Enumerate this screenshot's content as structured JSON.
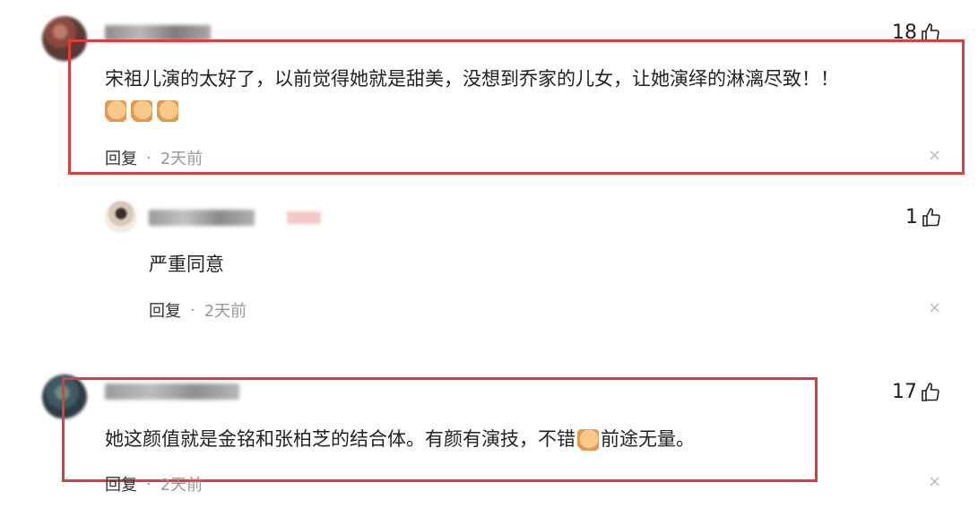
{
  "comments": [
    {
      "likes": "18",
      "text": "宋祖儿演的太好了，以前觉得她就是甜美，没想到乔家的儿女，让她演绎的淋漓尽致！！",
      "emoji": [
        "thumbs-up",
        "thumbs-up",
        "thumbs-up"
      ],
      "reply_label": "回复",
      "separator": "·",
      "time": "2天前",
      "close": "×"
    },
    {
      "likes": "1",
      "text": "严重同意",
      "reply_label": "回复",
      "separator": "·",
      "time": "2天前",
      "close": "×"
    },
    {
      "likes": "17",
      "text_before": "她这颜值就是金铭和张柏芝的结合体。有颜有演技，不错",
      "text_after": "前途无量。",
      "reply_label": "回复",
      "separator": "·",
      "time": "2天前",
      "close": "×"
    }
  ],
  "colors": {
    "highlight_box": "#e23b3b",
    "meta_text": "#999999"
  }
}
